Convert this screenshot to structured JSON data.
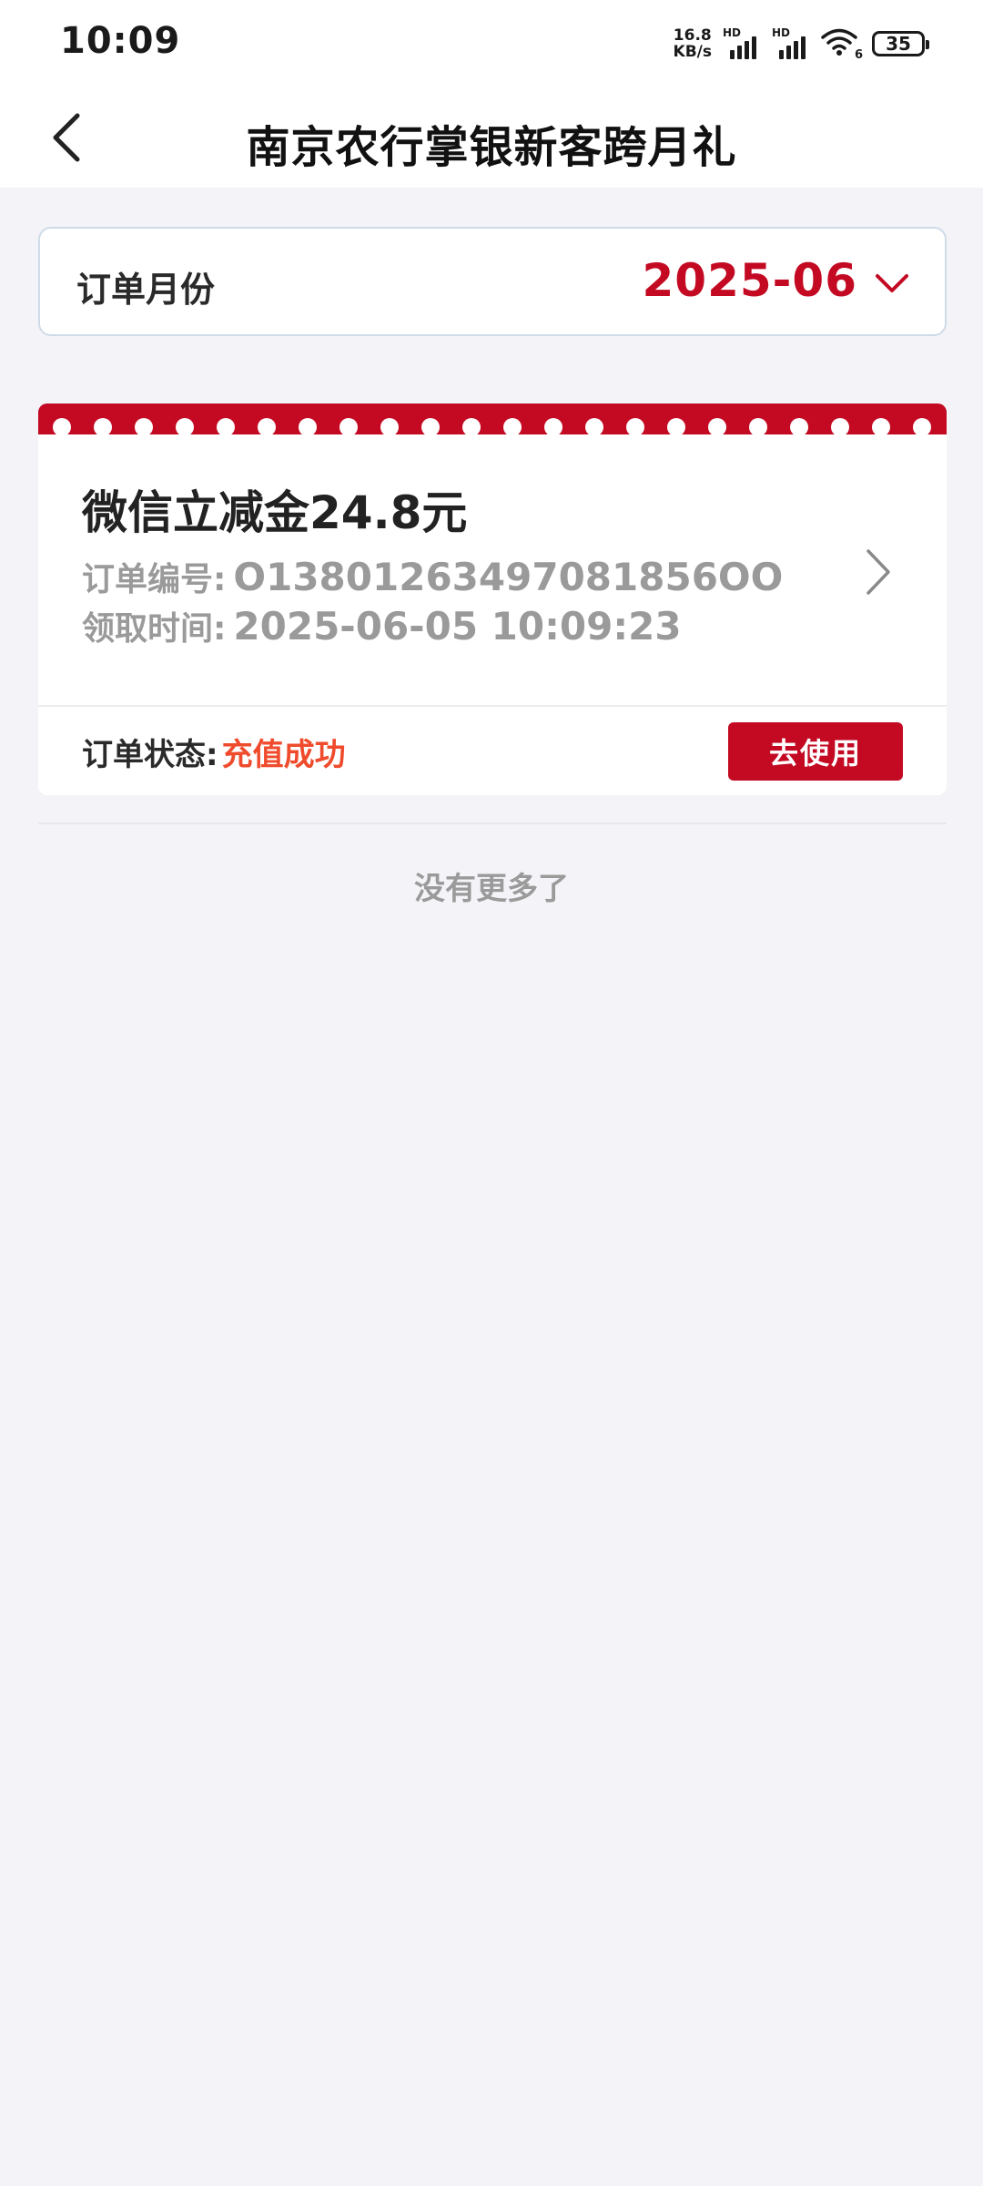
{
  "status_bar": {
    "time": "10:09",
    "net_speed_value": "16.8",
    "net_speed_unit": "KB/s",
    "sim1_label": "HD",
    "sim2_label": "HD",
    "wifi_label": "6",
    "battery_level": "35"
  },
  "header": {
    "title": "南京农行掌银新客跨月礼",
    "back_icon": "chevron-left-icon"
  },
  "month_selector": {
    "label": "订单月份",
    "value": "2025-06",
    "icon": "chevron-down-icon"
  },
  "orders": [
    {
      "title": "微信立减金24.8元",
      "order_no_label": "订单编号:",
      "order_no": "O13801263497081856OO",
      "claim_time_label": "领取时间:",
      "claim_time": "2025-06-05 10:09:23",
      "status_label": "订单状态:",
      "status": "充值成功",
      "action_label": "去使用"
    }
  ],
  "footer": {
    "no_more": "没有更多了"
  },
  "colors": {
    "brand_red": "#c40a23",
    "status_orange": "#ef4b2c",
    "page_bg": "#f3f3f8"
  }
}
